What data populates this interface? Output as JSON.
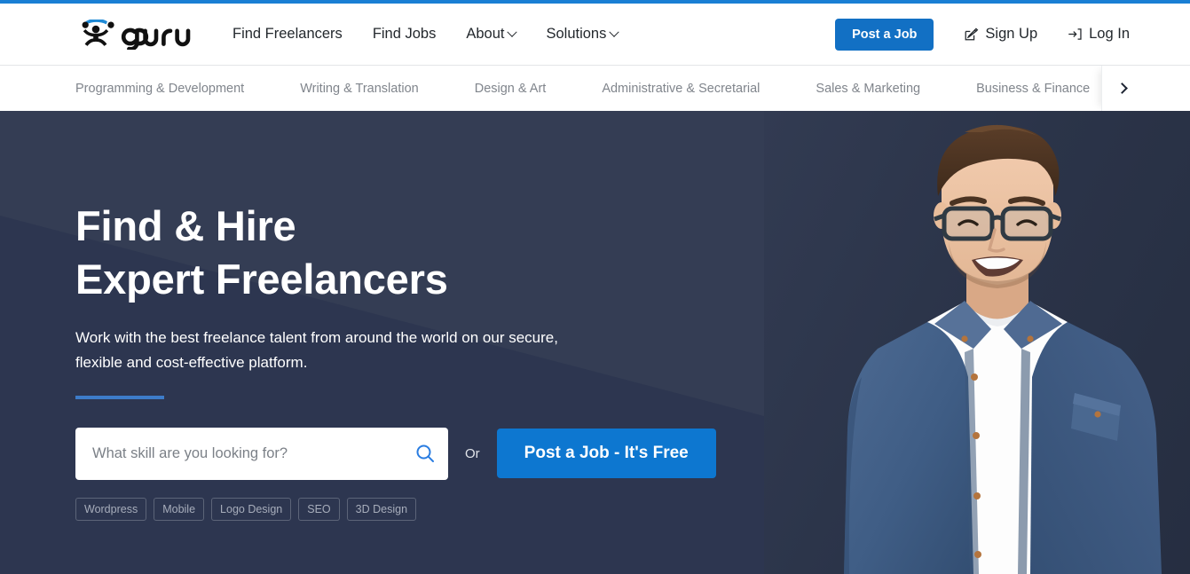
{
  "brand": {
    "name": "guru",
    "logo_icon": "guru-stick-figure-logo",
    "accent_blue": "#1270c4",
    "top_rule_color": "#1a7fd4"
  },
  "header": {
    "nav": [
      {
        "label": "Find Freelancers",
        "has_dropdown": false
      },
      {
        "label": "Find Jobs",
        "has_dropdown": false
      },
      {
        "label": "About",
        "has_dropdown": true
      },
      {
        "label": "Solutions",
        "has_dropdown": true
      }
    ],
    "post_job_label": "Post a Job",
    "sign_up_label": "Sign Up",
    "log_in_label": "Log In"
  },
  "categories": {
    "items": [
      "Programming & Development",
      "Writing & Translation",
      "Design & Art",
      "Administrative & Secretarial",
      "Sales & Marketing",
      "Business & Finance"
    ],
    "scroll_next_icon": "chevron-right-icon"
  },
  "hero": {
    "title_line1": "Find & Hire",
    "title_line2": "Expert Freelancers",
    "subtitle_line1": "Work with the best freelance talent from around the world on our secure,",
    "subtitle_line2": "flexible and cost-effective platform.",
    "accent_rule_color": "#3d7cc9",
    "background_color": "#343d54",
    "wedge_color": "#2d3650",
    "search": {
      "placeholder": "What skill are you looking for?",
      "value": "",
      "icon": "search-icon",
      "icon_color": "#2a7de1"
    },
    "or_label": "Or",
    "cta_label": "Post a Job - It's Free",
    "cta_color": "#0d77d0",
    "tags": [
      "Wordpress",
      "Mobile",
      "Logo Design",
      "SEO",
      "3D Design"
    ],
    "photo_alt": "smiling man with glasses in denim shirt"
  }
}
